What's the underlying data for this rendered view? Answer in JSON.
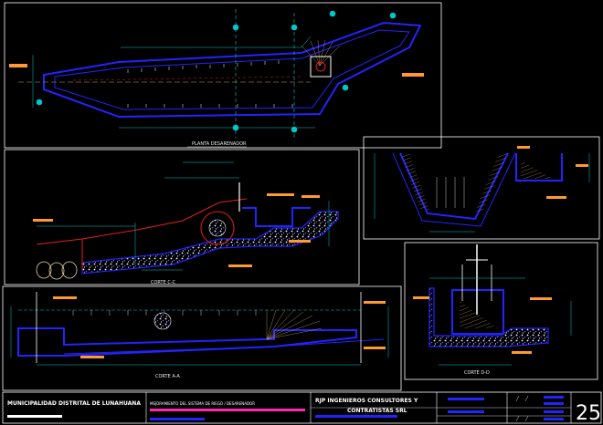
{
  "drawing": {
    "views": {
      "plan": "PLANTA DESARENADOR",
      "section_c": "CORTE C-C",
      "section_a": "CORTE A-A",
      "section_d": "CORTE D-D"
    },
    "title_block": {
      "client": "MUNICIPALIDAD DISTRITAL DE LUNAHUANA",
      "project": "MEJORAMIENTO DEL SISTEMA DE RIEGO / DESARENADOR",
      "consultant_line1": "RJP INGENIEROS CONSULTORES Y",
      "consultant_line2": "CONTRATISTAS SRL",
      "sheet_number": "25"
    },
    "colors": {
      "frame": "#ffffff",
      "concrete": "#2323ff",
      "dimension": "#00c8c8",
      "ground": "#e02020",
      "hatch": "#c8a064",
      "callout": "#ff9a30",
      "title_accent": "#ff2ab0"
    }
  }
}
